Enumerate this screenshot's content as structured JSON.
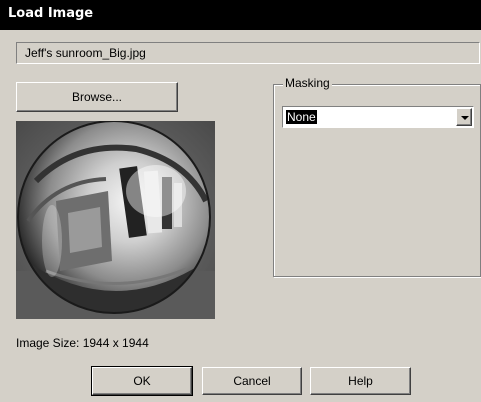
{
  "window": {
    "title": "Load Image"
  },
  "file": {
    "path": "Jeff's sunroom_Big.jpg"
  },
  "buttons": {
    "browse": "Browse...",
    "ok": "OK",
    "cancel": "Cancel",
    "help": "Help"
  },
  "masking": {
    "label": "Masking",
    "selected": "None"
  },
  "image_info": {
    "size_text": "Image Size: 1944 x 1944"
  },
  "preview": {
    "icon": "mirror-ball-preview-image"
  }
}
